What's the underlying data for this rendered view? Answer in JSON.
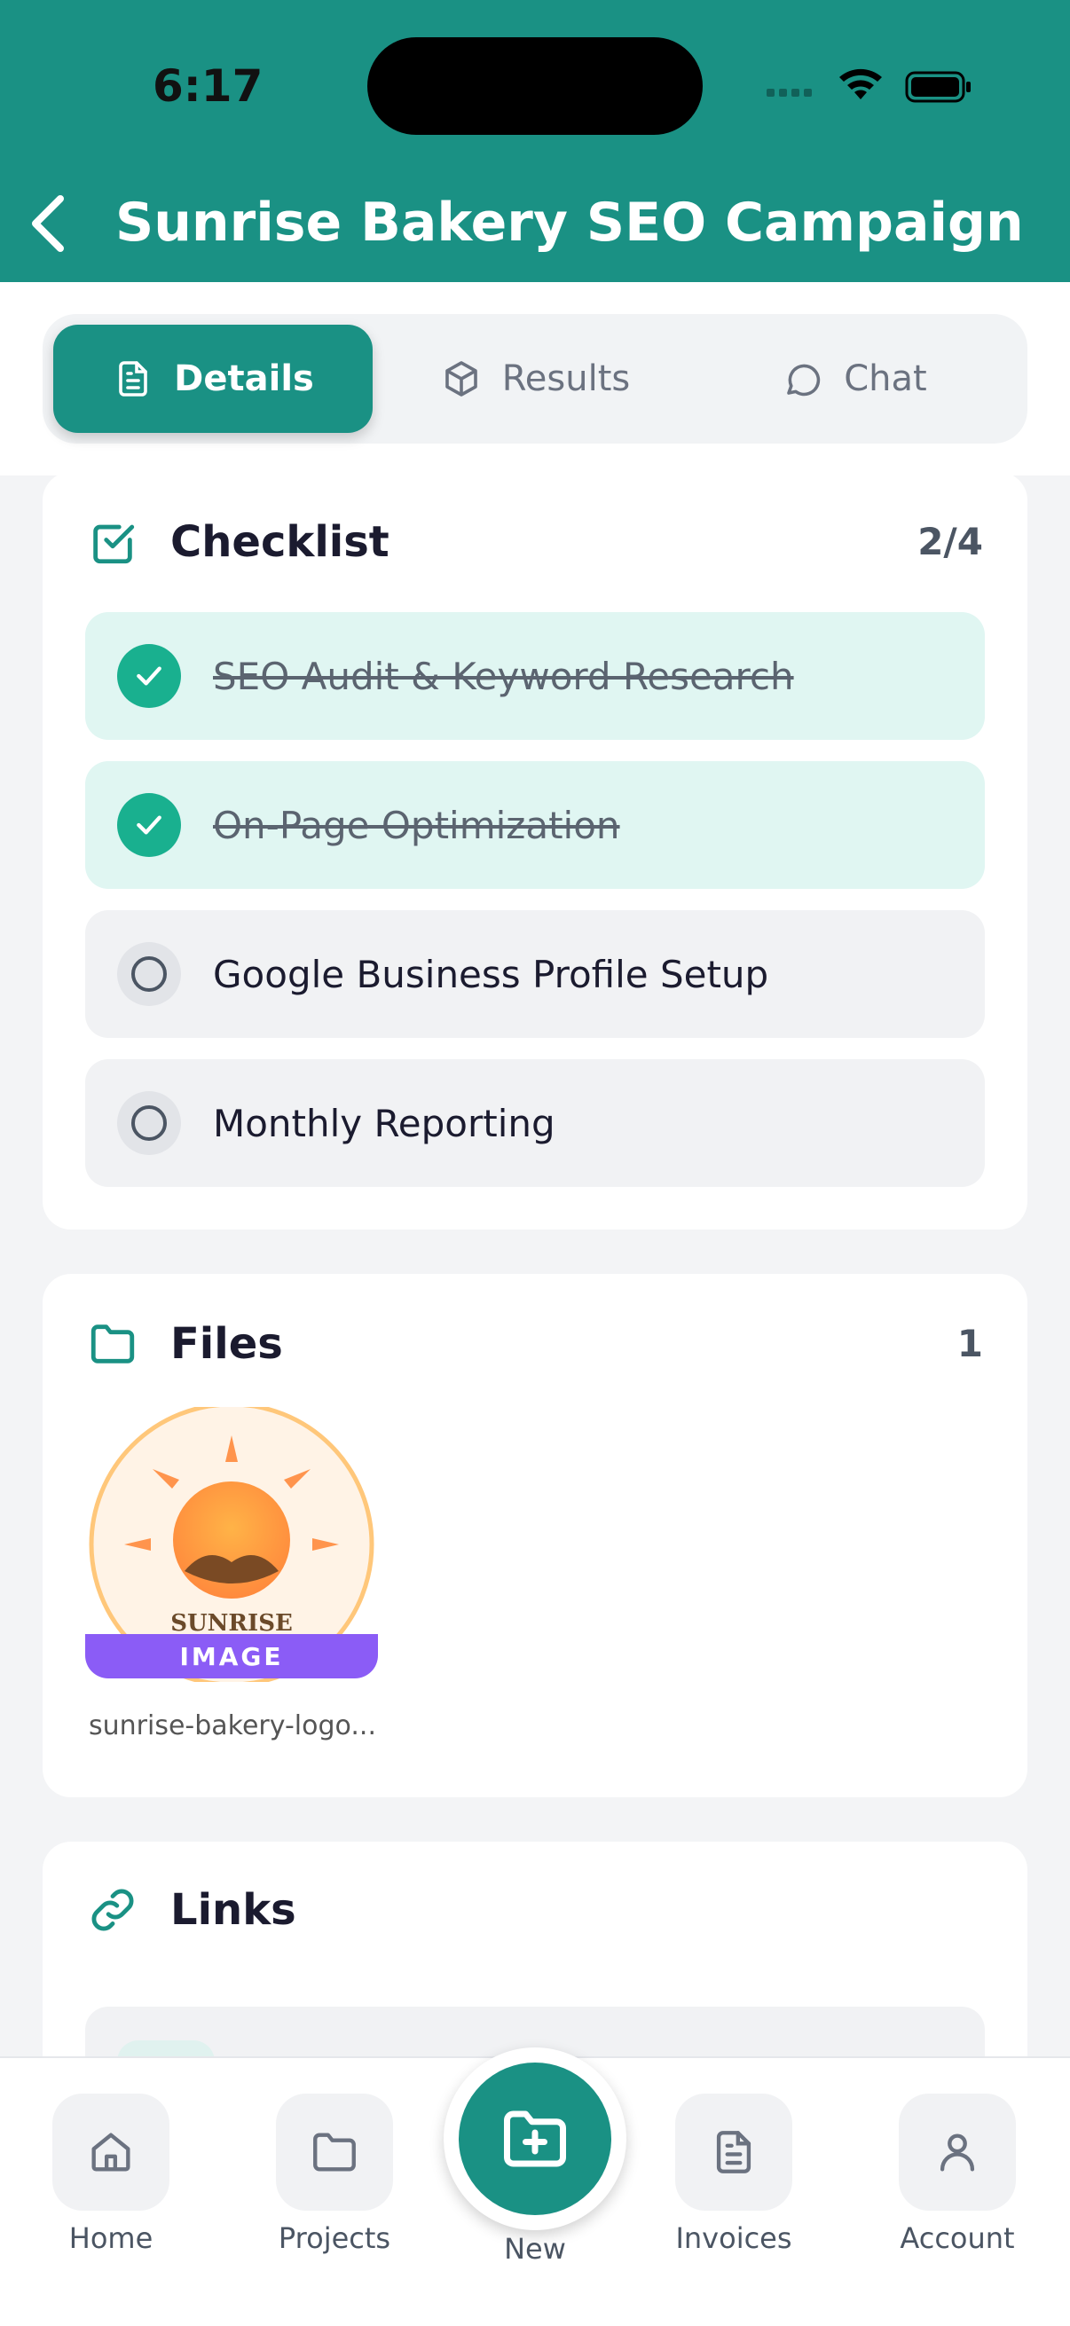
{
  "status": {
    "time": "6:17"
  },
  "header": {
    "title": "Sunrise Bakery SEO Campaign"
  },
  "tabs": [
    {
      "label": "Details",
      "icon": "document-icon",
      "active": true
    },
    {
      "label": "Results",
      "icon": "cube-icon",
      "active": false
    },
    {
      "label": "Chat",
      "icon": "chat-bubble-icon",
      "active": false
    }
  ],
  "checklist": {
    "title": "Checklist",
    "count": "2/4",
    "items": [
      {
        "label": "SEO Audit & Keyword Research",
        "done": true
      },
      {
        "label": "On-Page Optimization",
        "done": true
      },
      {
        "label": "Google Business Profile Setup",
        "done": false
      },
      {
        "label": "Monthly Reporting",
        "done": false
      }
    ]
  },
  "files": {
    "title": "Files",
    "count": "1",
    "items": [
      {
        "badge": "IMAGE",
        "name": "sunrise-bakery-logo...",
        "thumb_text": "SUNRISE"
      }
    ]
  },
  "links": {
    "title": "Links"
  },
  "nav": {
    "items": [
      {
        "label": "Home",
        "icon": "home-icon"
      },
      {
        "label": "Projects",
        "icon": "folder-icon"
      },
      {
        "label": "New",
        "icon": "folder-plus-icon"
      },
      {
        "label": "Invoices",
        "icon": "invoice-icon"
      },
      {
        "label": "Account",
        "icon": "user-icon"
      }
    ]
  },
  "colors": {
    "primary": "#1a9184",
    "done_bg": "#e0f6f2",
    "check": "#19b08f",
    "badge": "#8b5cf6"
  }
}
